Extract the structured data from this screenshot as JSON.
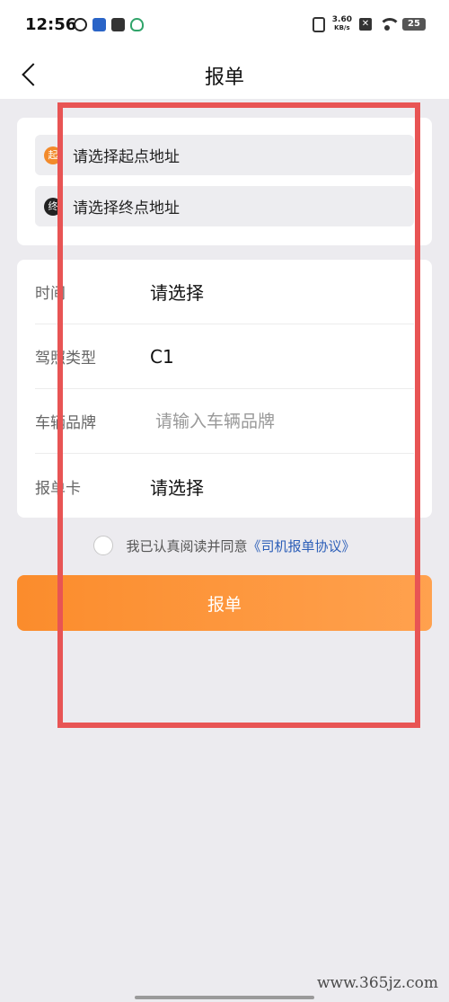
{
  "status_bar": {
    "time": "12:56",
    "net_speed_value": "3.60",
    "net_speed_unit": "KB/s",
    "battery": "25",
    "icons": [
      "app-icon-1",
      "app-icon-2",
      "mail-icon",
      "app-icon-4",
      "vibrate-icon",
      "x-icon",
      "wifi-icon",
      "battery-icon"
    ]
  },
  "nav": {
    "title": "报单",
    "back_icon": "chevron-left-icon"
  },
  "address": {
    "start_badge": "起",
    "start_placeholder": "请选择起点地址",
    "end_badge": "终",
    "end_placeholder": "请选择终点地址"
  },
  "form": {
    "rows": [
      {
        "label": "时间",
        "value": "请选择"
      },
      {
        "label": "驾照类型",
        "value": "C1"
      },
      {
        "label": "车辆品牌",
        "placeholder": "请输入车辆品牌"
      },
      {
        "label": "报单卡",
        "value": "请选择"
      }
    ]
  },
  "agreement": {
    "text": "我已认真阅读并同意",
    "link": "《司机报单协议》"
  },
  "submit": {
    "label": "报单"
  },
  "watermark": "www.365jz.com",
  "colors": {
    "accent": "#fb8c2c",
    "link": "#2d5fb8",
    "annotation_box": "#e85454",
    "background": "#ecebef"
  }
}
